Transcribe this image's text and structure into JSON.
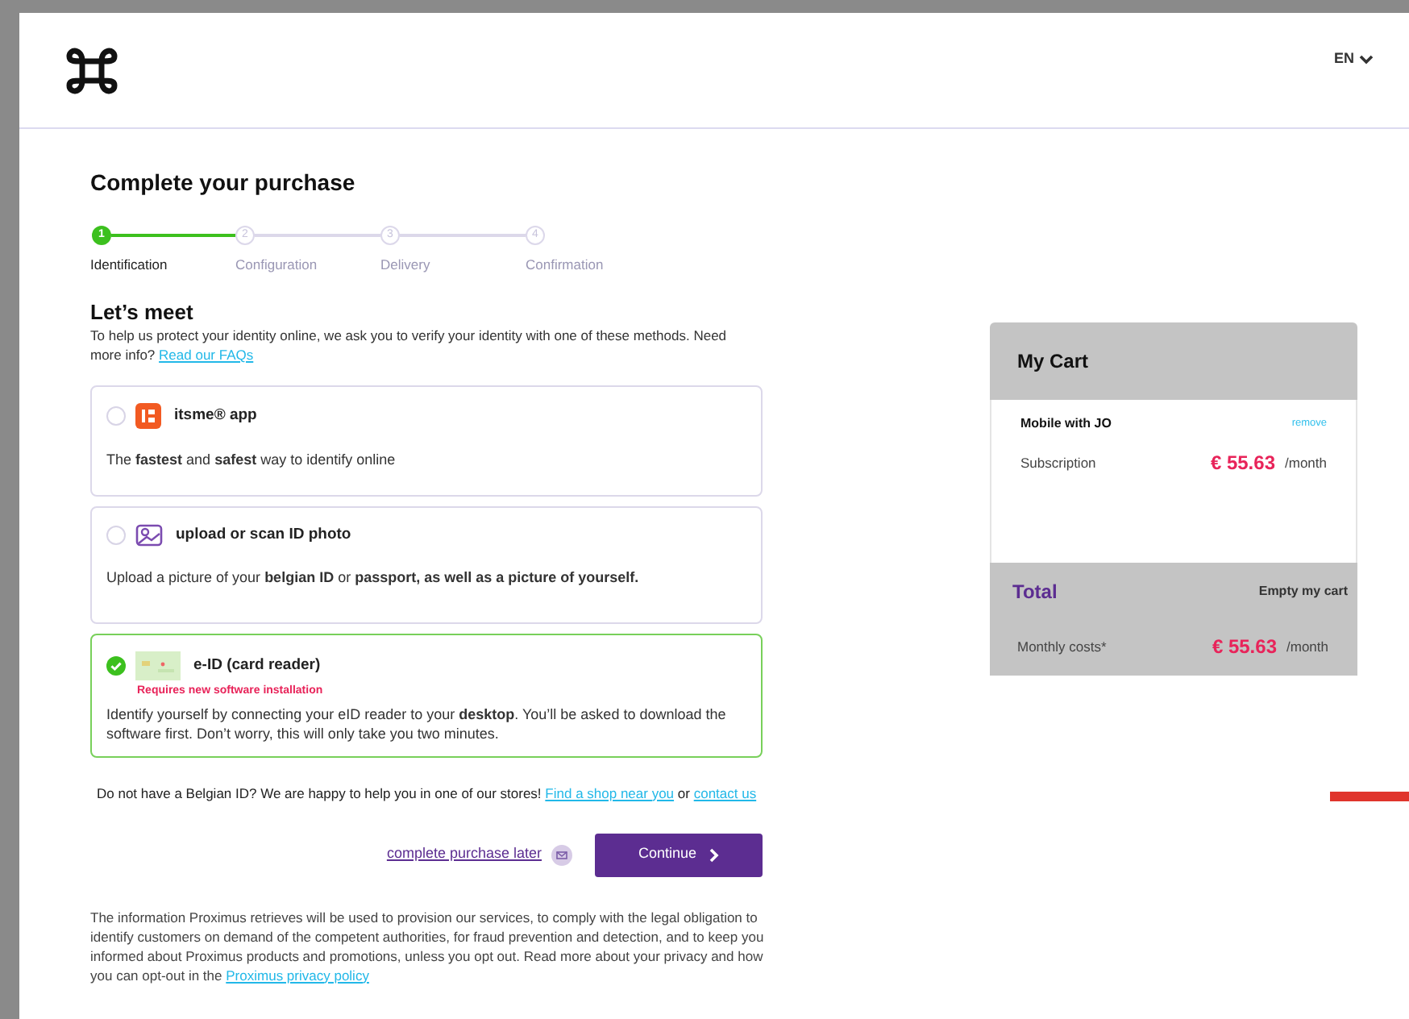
{
  "header": {
    "language": "EN"
  },
  "title": "Complete your purchase",
  "steps": [
    {
      "number": "1",
      "label": "Identification",
      "selected": true
    },
    {
      "number": "2",
      "label": "Configuration",
      "selected": false
    },
    {
      "number": "3",
      "label": "Delivery",
      "selected": false
    },
    {
      "number": "4",
      "label": "Confirmation",
      "selected": false
    }
  ],
  "intro": {
    "heading": "Let’s meet",
    "text": "To help us protect your identity online, we ask you to verify your identity with one of these methods. Need more info?",
    "link": "Read our FAQs"
  },
  "methods": [
    {
      "kind": "itsme",
      "title": "itsme® app",
      "description": "The **fastest** and **safest** way to identify online",
      "selected": false
    },
    {
      "kind": "upload",
      "title": "upload or scan ID photo",
      "description": "Upload a picture of your  **belgian ID** or **passport, as well as a picture of yourself.**",
      "selected": false
    },
    {
      "kind": "eid",
      "title": "e-ID (card reader)",
      "warning": "Requires new software installation",
      "description": "Identify yourself by connecting your eID reader to your **desktop**. You’ll be asked to download the software first. Don’t worry, this will only take you two minutes.",
      "selected": true
    }
  ],
  "help": {
    "text": "Do not have a Belgian ID? We are happy to help you in one of our stores!",
    "link": "Find a shop near you",
    "connector": "or",
    "link2": "contact us"
  },
  "actions": {
    "later": "complete purchase later",
    "continue": "Continue"
  },
  "legal": {
    "text": "The information Proximus retrieves will be used to provision our services, to comply with the legal obligation to identify customers on demand of the competent authorities, for fraud prevention and detection, and to keep you informed about Proximus products and promotions, unless you opt out. Read more about your privacy and how you can opt-out in the",
    "link": "Proximus privacy policy"
  },
  "cart": {
    "title": "My Cart",
    "product": "Mobile with JO",
    "remove": "remove",
    "line_label": "Subscription",
    "line_price": "€ 55.63",
    "line_period": "/month",
    "total_title": "Total",
    "empty": "Empty my cart",
    "total_label": "Monthly costs*",
    "total_price": "€ 55.63",
    "total_period": "/month"
  }
}
